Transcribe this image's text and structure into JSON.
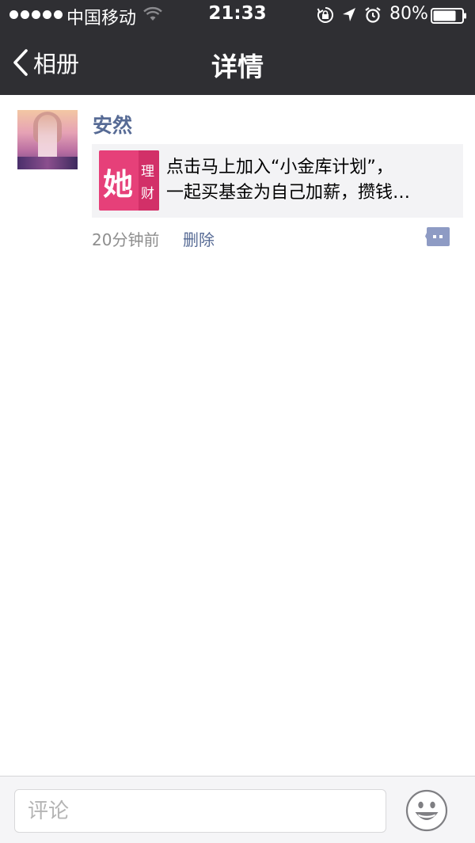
{
  "status_bar": {
    "carrier": "中国移动",
    "time": "21:33",
    "battery": "80%",
    "battery_level": 0.8
  },
  "nav": {
    "back_label": "相册",
    "title": "详情"
  },
  "post": {
    "author": "安然",
    "share": {
      "thumb_main": "她",
      "thumb_sub1": "理",
      "thumb_sub2": "财",
      "text_line1": "点击马上加入“小金库计划”，",
      "text_line2": "一起买基金为自己加薪，攒钱…"
    },
    "time": "20分钟前",
    "delete_label": "删除"
  },
  "comment_bar": {
    "placeholder": "评论"
  },
  "colors": {
    "header_bg": "#2f2f33",
    "link_blue": "#576b95",
    "brand_pink": "#e64079"
  },
  "icons": [
    "wifi-icon",
    "rotation-lock-icon",
    "location-icon",
    "alarm-icon",
    "battery-icon",
    "back-chevron-icon",
    "comment-bubble-icon",
    "emoji-icon"
  ]
}
